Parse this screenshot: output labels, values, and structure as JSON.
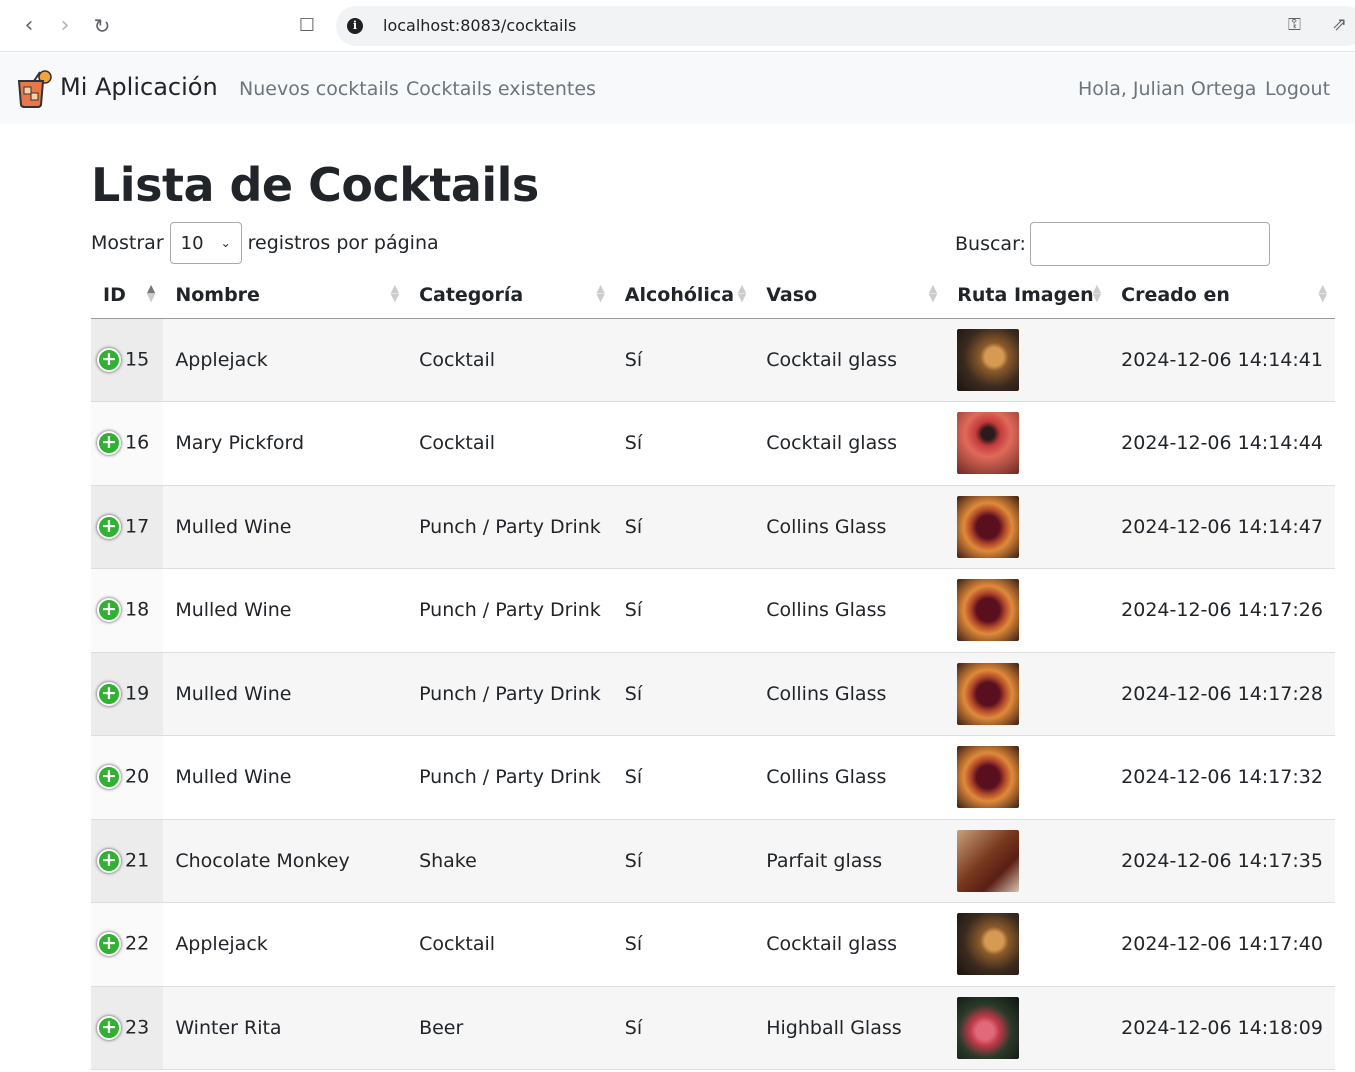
{
  "browser": {
    "url": "localhost:8083/cocktails"
  },
  "navbar": {
    "brand": "Mi Aplicación",
    "links": [
      "Nuevos cocktails",
      "Cocktails existentes"
    ],
    "greeting": "Hola, Julian Ortega",
    "logout": "Logout"
  },
  "page": {
    "title": "Lista de Cocktails",
    "show_label": "Mostrar",
    "page_size": "10",
    "per_page_label": "registros por página",
    "search_label": "Buscar:",
    "search_value": ""
  },
  "table": {
    "columns": [
      "ID",
      "Nombre",
      "Categoría",
      "Alcohólica",
      "Vaso",
      "Ruta Imagen",
      "Creado en"
    ],
    "rows": [
      {
        "id": "15",
        "nombre": "Applejack",
        "categoria": "Cocktail",
        "alcoholica": "Sí",
        "vaso": "Cocktail glass",
        "img": "applejack",
        "creado": "2024-12-06 14:14:41"
      },
      {
        "id": "16",
        "nombre": "Mary Pickford",
        "categoria": "Cocktail",
        "alcoholica": "Sí",
        "vaso": "Cocktail glass",
        "img": "mary",
        "creado": "2024-12-06 14:14:44"
      },
      {
        "id": "17",
        "nombre": "Mulled Wine",
        "categoria": "Punch / Party Drink",
        "alcoholica": "Sí",
        "vaso": "Collins Glass",
        "img": "mulled",
        "creado": "2024-12-06 14:14:47"
      },
      {
        "id": "18",
        "nombre": "Mulled Wine",
        "categoria": "Punch / Party Drink",
        "alcoholica": "Sí",
        "vaso": "Collins Glass",
        "img": "mulled",
        "creado": "2024-12-06 14:17:26"
      },
      {
        "id": "19",
        "nombre": "Mulled Wine",
        "categoria": "Punch / Party Drink",
        "alcoholica": "Sí",
        "vaso": "Collins Glass",
        "img": "mulled",
        "creado": "2024-12-06 14:17:28"
      },
      {
        "id": "20",
        "nombre": "Mulled Wine",
        "categoria": "Punch / Party Drink",
        "alcoholica": "Sí",
        "vaso": "Collins Glass",
        "img": "mulled",
        "creado": "2024-12-06 14:17:32"
      },
      {
        "id": "21",
        "nombre": "Chocolate Monkey",
        "categoria": "Shake",
        "alcoholica": "Sí",
        "vaso": "Parfait glass",
        "img": "choc",
        "creado": "2024-12-06 14:17:35"
      },
      {
        "id": "22",
        "nombre": "Applejack",
        "categoria": "Cocktail",
        "alcoholica": "Sí",
        "vaso": "Cocktail glass",
        "img": "applejack",
        "creado": "2024-12-06 14:17:40"
      },
      {
        "id": "23",
        "nombre": "Winter Rita",
        "categoria": "Beer",
        "alcoholica": "Sí",
        "vaso": "Highball Glass",
        "img": "winter",
        "creado": "2024-12-06 14:18:09"
      }
    ]
  }
}
